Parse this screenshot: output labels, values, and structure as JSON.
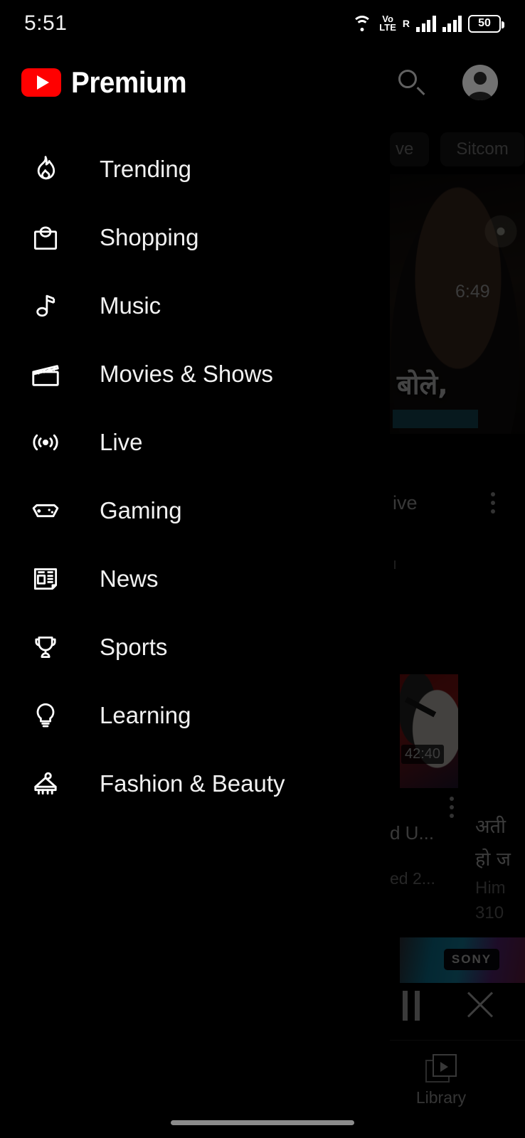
{
  "status_bar": {
    "time": "5:51",
    "wifi_icon": "wifi-icon",
    "volte_top": "Vo",
    "volte_bottom": "LTE",
    "roaming_label": "R",
    "signal_icon_1": "signal-bars-icon",
    "signal_icon_2": "signal-bars-icon",
    "battery_percent": "50"
  },
  "app_bar": {
    "logo_icon": "youtube-logo-icon",
    "brand_word": "Premium",
    "search_icon": "search-icon",
    "avatar_icon": "account-avatar-icon"
  },
  "drawer": {
    "items": [
      {
        "label": "Trending",
        "icon": "flame-icon"
      },
      {
        "label": "Shopping",
        "icon": "shopping-bag-icon"
      },
      {
        "label": "Music",
        "icon": "music-note-icon"
      },
      {
        "label": "Movies & Shows",
        "icon": "clapperboard-icon"
      },
      {
        "label": "Live",
        "icon": "broadcast-icon"
      },
      {
        "label": "Gaming",
        "icon": "gamepad-icon"
      },
      {
        "label": "News",
        "icon": "newspaper-icon"
      },
      {
        "label": "Sports",
        "icon": "trophy-icon"
      },
      {
        "label": "Learning",
        "icon": "lightbulb-icon"
      },
      {
        "label": "Fashion & Beauty",
        "icon": "clothes-hanger-icon"
      }
    ]
  },
  "background": {
    "chips": [
      {
        "label": "ve"
      },
      {
        "label": "Sitcom"
      }
    ],
    "featured_video": {
      "thumbnail_caption": "बोले,",
      "duration": "6:49"
    },
    "video_row_1": {
      "title_fragment": "ive",
      "kebab_icon": "more-options-icon"
    },
    "video_row_2": {
      "duration": "42:40",
      "title_fragment_1": "d U...",
      "title_fragment_2": "ed 2...",
      "kebab_icon": "more-options-icon"
    },
    "video_row_3": {
      "title_line_1": "अती",
      "title_line_2": "हो ज",
      "channel": "Him",
      "views": "310"
    },
    "mini_player": {
      "thumbnail_brand": "SONY",
      "pause_icon": "pause-icon",
      "close_icon": "close-icon"
    },
    "bottom_tab": {
      "label": "Library",
      "icon": "library-icon"
    }
  }
}
